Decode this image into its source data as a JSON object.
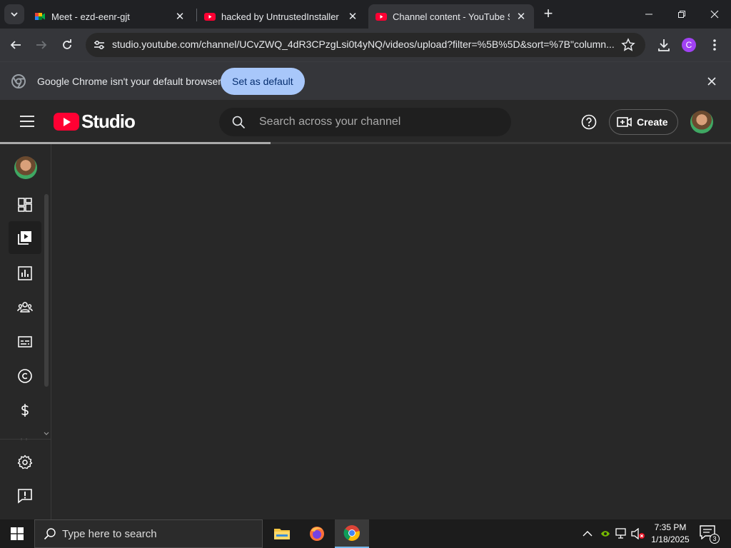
{
  "browser": {
    "tabs": [
      {
        "title": "Meet - ezd-eenr-gjt",
        "active": false,
        "favicon": "google-meet-icon"
      },
      {
        "title": "hacked by UntrustedInstaller - YouTube",
        "active": false,
        "favicon": "youtube-icon"
      },
      {
        "title": "Channel content - YouTube Studio",
        "active": true,
        "favicon": "youtube-studio-icon"
      }
    ],
    "url": "studio.youtube.com/channel/UCvZWQ_4dR3CPzgLsi0t4yNQ/videos/upload?filter=%5B%5D&sort=%7B\"column...",
    "profile_initial": "C",
    "infobar": {
      "message": "Google Chrome isn't your default browser",
      "button": "Set as default"
    }
  },
  "studio": {
    "search_placeholder": "Search across your channel",
    "create_label": "Create",
    "load_progress": 0.37,
    "sidenav": [
      "avatar",
      "dashboard-icon",
      "content-icon",
      "analytics-icon",
      "community-icon",
      "subtitles-icon",
      "copyright-icon",
      "earn-icon",
      "settings-icon",
      "feedback-icon"
    ],
    "selected_nav": "content"
  },
  "taskbar": {
    "search_placeholder": "Type here to search",
    "time": "7:35 PM",
    "date": "1/18/2025",
    "notifications": "3"
  },
  "colors": {
    "youtube_red": "#ff0033",
    "set_default_bg": "#a8c7fa",
    "page_bg": "#282828"
  }
}
